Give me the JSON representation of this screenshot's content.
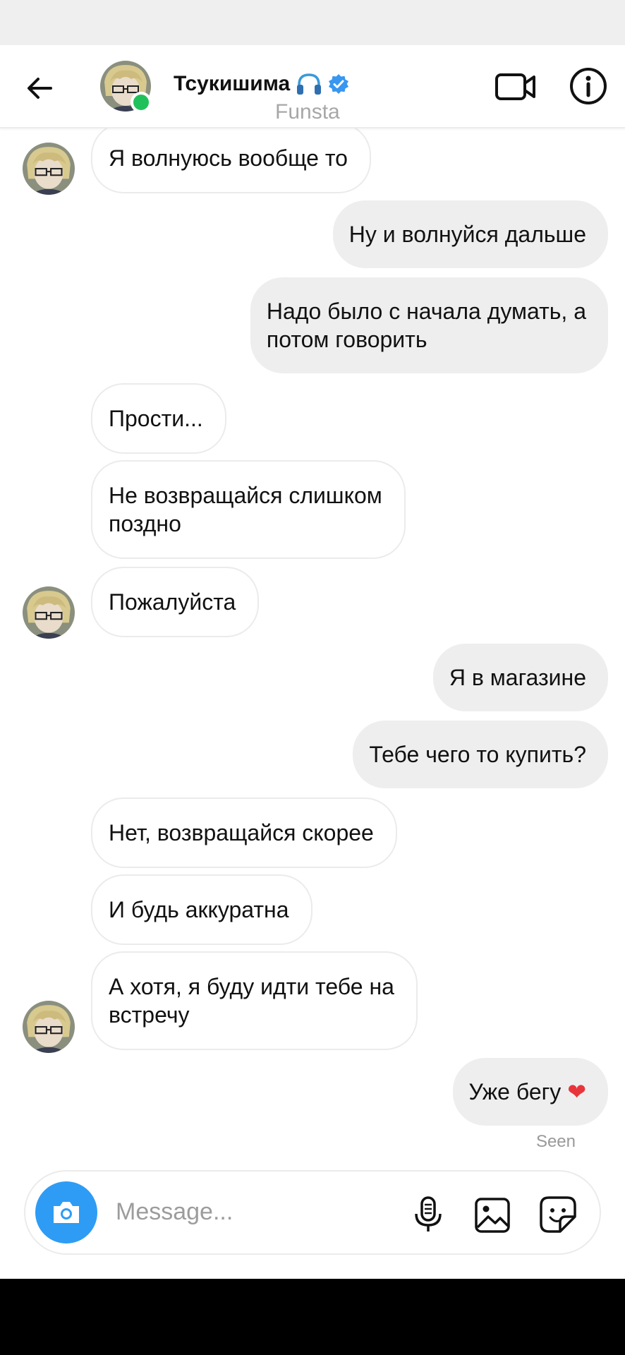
{
  "header": {
    "title": "Тсукишима",
    "subtitle": "Funsta",
    "online": true
  },
  "messages": [
    {
      "dir": "in",
      "text": "Я волнуюсь вообще то",
      "avatar": true
    },
    {
      "dir": "out",
      "text": "Ну и волнуйся дальше"
    },
    {
      "dir": "out",
      "text": "Надо было с начала думать, а\nпотом говорить"
    },
    {
      "dir": "in",
      "text": "Прости..."
    },
    {
      "dir": "in",
      "text": "Не возвращайся слишком\nпоздно"
    },
    {
      "dir": "in",
      "text": "Пожалуйста",
      "avatar": true
    },
    {
      "dir": "out",
      "text": "Я в магазине"
    },
    {
      "dir": "out",
      "text": "Тебе чего то купить?"
    },
    {
      "dir": "in",
      "text": "Нет, возвращайся скорее"
    },
    {
      "dir": "in",
      "text": "И будь аккуратна"
    },
    {
      "dir": "in",
      "text": "А хотя, я буду идти тебе на\nвстречу",
      "avatar": true
    },
    {
      "dir": "out",
      "text": "Уже бегу ❤️"
    }
  ],
  "seen_label": "Seen",
  "composer": {
    "placeholder": "Message..."
  },
  "colors": {
    "verified": "#3897f0",
    "online": "#20c15a",
    "camera_button": "#2e9cf4",
    "outgoing_bubble": "#eeeeef",
    "heart": "#e8353b"
  },
  "icons": [
    "back-arrow-icon",
    "headphones-icon",
    "verified-badge-icon",
    "video-call-icon",
    "info-icon",
    "camera-icon",
    "microphone-icon",
    "gallery-icon",
    "sticker-icon"
  ]
}
